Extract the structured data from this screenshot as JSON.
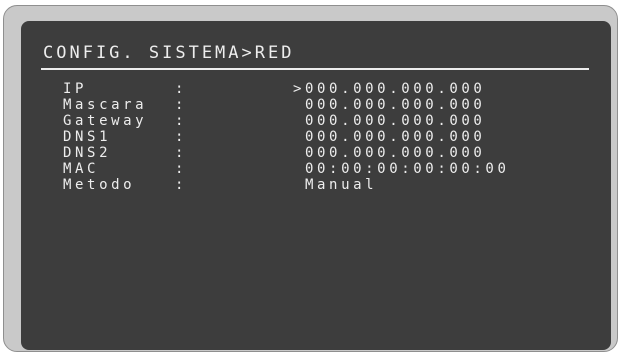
{
  "screen": {
    "title": "CONFIG. SISTEMA>RED",
    "cursor_symbol": ">",
    "rows": [
      {
        "label": "IP",
        "colon": ":",
        "value": "000.000.000.000",
        "selected": true
      },
      {
        "label": "Mascara",
        "colon": ":",
        "value": "000.000.000.000",
        "selected": false
      },
      {
        "label": "Gateway",
        "colon": ":",
        "value": "000.000.000.000",
        "selected": false
      },
      {
        "label": "DNS1",
        "colon": ":",
        "value": "000.000.000.000",
        "selected": false
      },
      {
        "label": "DNS2",
        "colon": ":",
        "value": "000.000.000.000",
        "selected": false
      },
      {
        "label": "MAC",
        "colon": ":",
        "value": "00:00:00:00:00:00",
        "selected": false
      },
      {
        "label": "Metodo",
        "colon": ":",
        "value": "Manual",
        "selected": false
      }
    ]
  },
  "colors": {
    "screen_background": "#3d3d3d",
    "screen_text": "#ededed",
    "bezel": "#c9c9c9"
  }
}
